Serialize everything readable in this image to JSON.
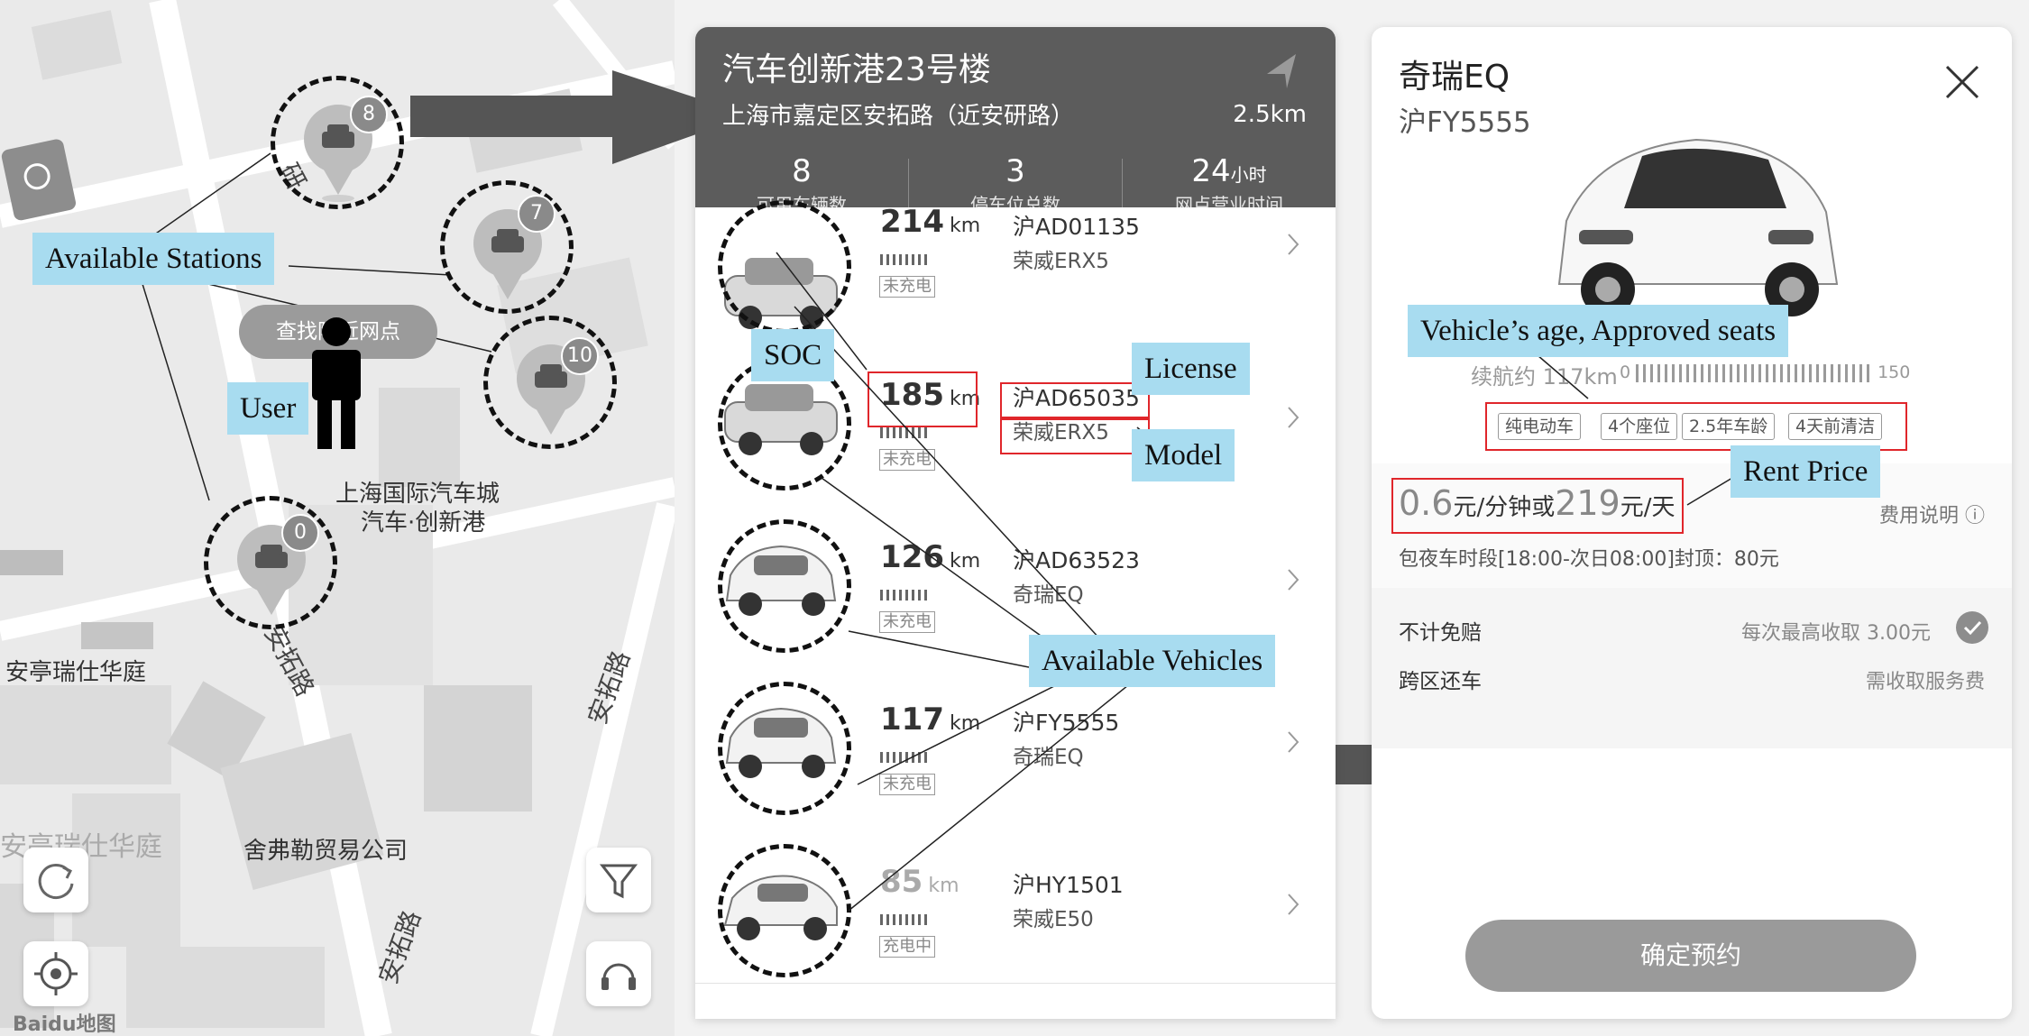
{
  "map": {
    "place_labels": [
      "上海国际汽车城",
      "汽车·创新港",
      "安亭瑞仕华庭",
      "安亭瑞仕华庭",
      "舍弗勒贸易公司"
    ],
    "road_labels": [
      "安拓路",
      "安拓路",
      "研",
      "安拓路",
      "安拓路"
    ],
    "search_chip": "查找附近网点",
    "station_counts": [
      "8",
      "7",
      "10",
      "0"
    ],
    "logo": "Baidu地图"
  },
  "annotations": {
    "available_stations": "Available Stations",
    "user": "User",
    "soc": "SOC",
    "license": "License",
    "model": "Model",
    "available_vehicles": "Available Vehicles",
    "vehicle_age_seats": "Vehicle’s age, Approved seats",
    "rent_price": "Rent Price"
  },
  "station": {
    "name": "汽车创新港23号楼",
    "address": "上海市嘉定区安拓路（近安研路）",
    "distance": "2.5km",
    "stats": [
      {
        "value": "8",
        "unit": "",
        "label": "可用车辆数"
      },
      {
        "value": "3",
        "unit": "",
        "label": "停车位总数"
      },
      {
        "value": "24",
        "unit": "小时",
        "label": "网点营业时间"
      }
    ]
  },
  "vehicles": [
    {
      "range": "214",
      "unit": "km",
      "plate": "沪AD01135",
      "model": "荣威ERX5",
      "charge": "未充电"
    },
    {
      "range": "185",
      "unit": "km",
      "plate": "沪AD65035",
      "model": "荣威ERX5",
      "charge": "未充电"
    },
    {
      "range": "126",
      "unit": "km",
      "plate": "沪AD63523",
      "model": "奇瑞EQ",
      "charge": "未充电"
    },
    {
      "range": "117",
      "unit": "km",
      "plate": "沪FY5555",
      "model": "奇瑞EQ",
      "charge": "未充电"
    },
    {
      "range": "85",
      "unit": "km",
      "plate": "沪HY1501",
      "model": "荣威E50",
      "charge": "充电中"
    }
  ],
  "detail": {
    "name": "奇瑞EQ",
    "plate": "沪FY5555",
    "range_label": "续航约",
    "range_value": "117km",
    "scale_min": "0",
    "scale_max": "150",
    "tags": [
      "纯电动车",
      "4个座位",
      "2.5年车龄",
      "4天前清洁"
    ],
    "price_per_min": "0.6",
    "price_min_unit": "元/分钟或",
    "price_per_day": "219",
    "price_day_unit": "元/天",
    "fee_info": "费用说明",
    "night_cap": "包夜车时段[18:00-次日08:00]封顶：80元",
    "insurance_label": "不计免赔",
    "insurance_value": "每次最高收取 3.00元",
    "return_label": "跨区还车",
    "return_value": "需收取服务费",
    "confirm": "确定预约"
  }
}
